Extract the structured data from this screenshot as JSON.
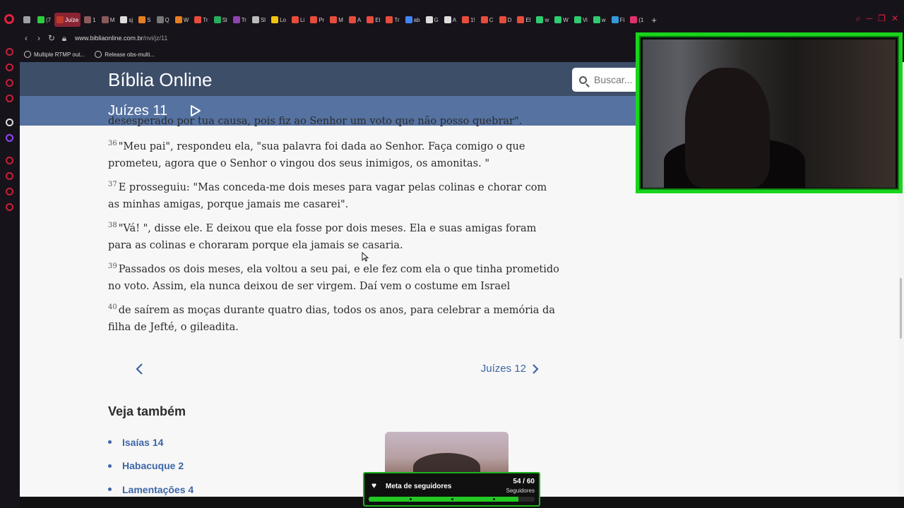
{
  "browser": {
    "tabs": [
      {
        "label": "",
        "color": "#9aa0a6"
      },
      {
        "label": "(7",
        "color": "#2ecc40"
      },
      {
        "label": "Juíze",
        "color": "#c0392b",
        "active": true
      },
      {
        "label": "1",
        "color": "#8b5a5a"
      },
      {
        "label": "M",
        "color": "#8b5a5a"
      },
      {
        "label": "sj",
        "color": "#dddddd"
      },
      {
        "label": "S",
        "color": "#e67e22"
      },
      {
        "label": "Q",
        "color": "#777777"
      },
      {
        "label": "W",
        "color": "#e67e22"
      },
      {
        "label": "Tr",
        "color": "#e74c3c"
      },
      {
        "label": "Sl",
        "color": "#27ae60"
      },
      {
        "label": "Tr",
        "color": "#8e44ad"
      },
      {
        "label": "Sl",
        "color": "#bbbbbb"
      },
      {
        "label": "Lo",
        "color": "#f1c40f"
      },
      {
        "label": "Li",
        "color": "#e74c3c"
      },
      {
        "label": "Pr",
        "color": "#e74c3c"
      },
      {
        "label": "M",
        "color": "#e74c3c"
      },
      {
        "label": "A",
        "color": "#e74c3c"
      },
      {
        "label": "El",
        "color": "#e74c3c"
      },
      {
        "label": "Tr",
        "color": "#e74c3c"
      },
      {
        "label": "ab",
        "color": "#4285f4"
      },
      {
        "label": "G",
        "color": "#dddddd"
      },
      {
        "label": "A",
        "color": "#dddddd"
      },
      {
        "label": "1!",
        "color": "#e74c3c"
      },
      {
        "label": "C",
        "color": "#e74c3c"
      },
      {
        "label": "D",
        "color": "#e74c3c"
      },
      {
        "label": "El",
        "color": "#e74c3c"
      },
      {
        "label": "w",
        "color": "#2ecc71"
      },
      {
        "label": "W",
        "color": "#2ecc71"
      },
      {
        "label": "Vi",
        "color": "#2ecc71"
      },
      {
        "label": "w",
        "color": "#2ecc71"
      },
      {
        "label": "Fi",
        "color": "#3498db"
      },
      {
        "label": "(1",
        "color": "#e1306c"
      }
    ],
    "url_host": "www.bibliaonline.com.br",
    "url_path": "/nvi/jz/11",
    "bookmarks": [
      "Multiple RTMP out...",
      "Release obs-multi..."
    ]
  },
  "site": {
    "title": "Bíblia Online",
    "search_placeholder": "Buscar...",
    "chapter_title": "Juízes 11"
  },
  "content": {
    "clipped_line": "desesperado por tua causa, pois fiz ao Senhor um voto que não posso quebrar\".",
    "verses": [
      {
        "num": "36",
        "text": "\"Meu pai\", respondeu ela, \"sua palavra foi dada ao Senhor. Faça comigo o que prometeu, agora que o Senhor o vingou dos seus inimigos, os amonitas. \""
      },
      {
        "num": "37",
        "text": "E prosseguiu: \"Mas conceda-me dois meses para vagar pelas colinas e chorar com as minhas amigas, porque jamais me casarei\"."
      },
      {
        "num": "38",
        "text": "\"Vá! \", disse ele. E deixou que ela fosse por dois meses. Ela e suas amigas foram para as colinas e choraram porque ela jamais se casaria."
      },
      {
        "num": "39",
        "text": "Passados os dois meses, ela voltou a seu pai, e ele fez com ela o que tinha prometido no voto. Assim, ela nunca deixou de ser virgem. Daí vem o costume em Israel"
      },
      {
        "num": "40",
        "text": "de saírem as moças durante quatro dias, todos os anos, para celebrar a memória da filha de Jefté, o gileadita."
      }
    ],
    "next_label": "Juízes 12"
  },
  "see_also": {
    "heading": "Veja também",
    "links": [
      "Isaías 14",
      "Habacuque 2",
      "Lamentações 4"
    ]
  },
  "goal": {
    "label": "Meta de seguidores",
    "count": "54 / 60",
    "sub": "Seguidores",
    "progress": 0.9
  },
  "colors": {
    "header": "#3d4e69",
    "chapter_bar": "#5572a1",
    "link": "#3d66a8",
    "webcam_border": "#19d41c"
  }
}
